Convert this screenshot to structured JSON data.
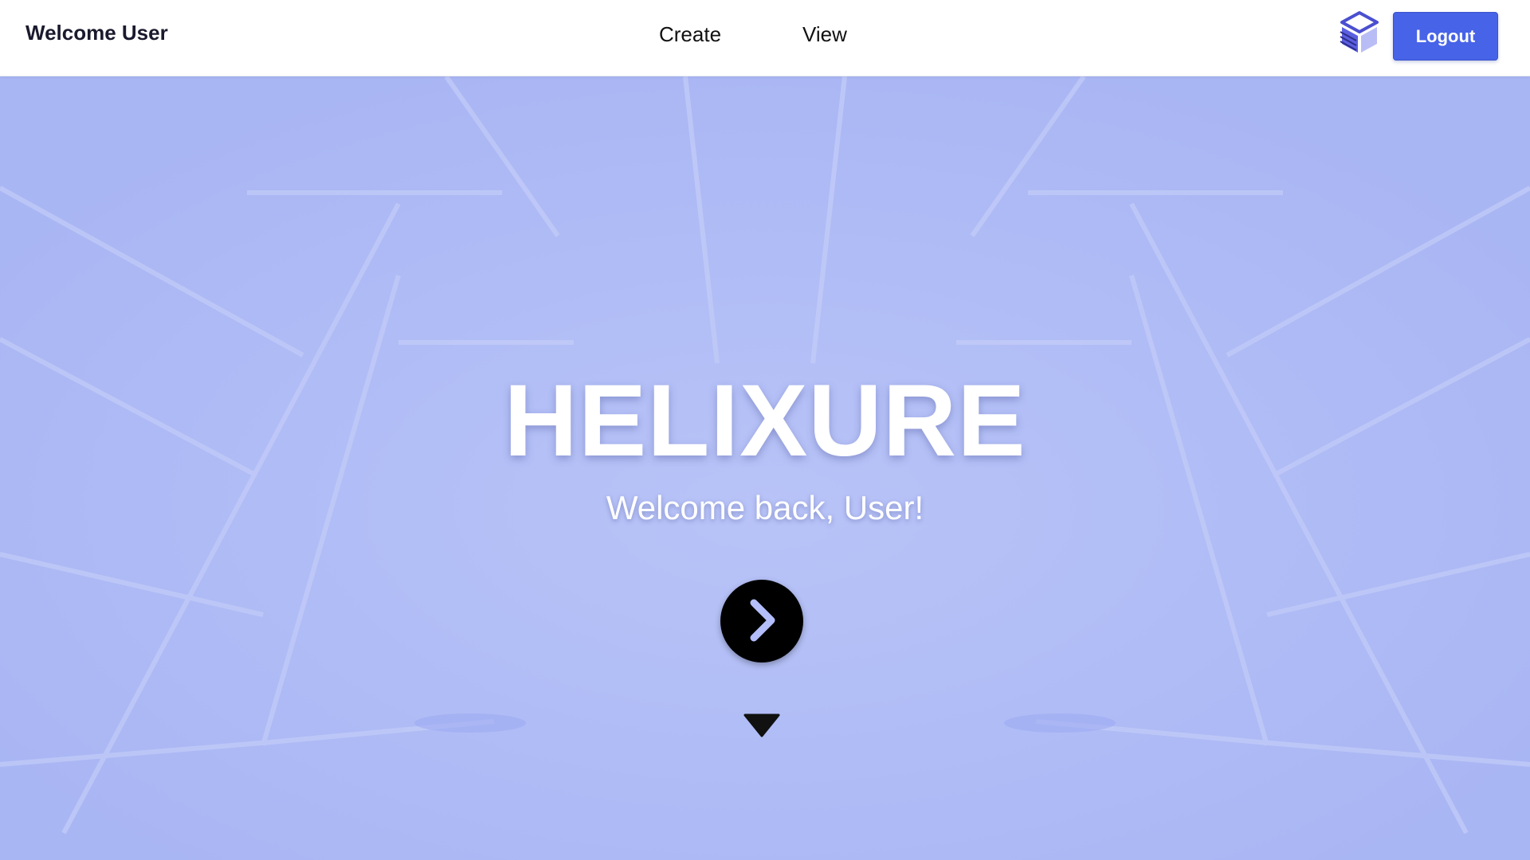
{
  "navbar": {
    "brand": "Welcome User",
    "links": [
      {
        "label": "Create"
      },
      {
        "label": "View"
      }
    ],
    "logo_icon": "stacked-cube-logo-icon",
    "logout_label": "Logout"
  },
  "hero": {
    "title": "HELIXURE",
    "subtitle": "Welcome back, User!",
    "next_icon": "chevron-right-icon",
    "scroll_icon": "triangle-down-icon"
  },
  "colors": {
    "accent": "#4763e8",
    "hero_background": "#aebaf5",
    "navbar_background": "#ffffff",
    "title_text": "#ffffff",
    "button_dark": "#000000"
  }
}
